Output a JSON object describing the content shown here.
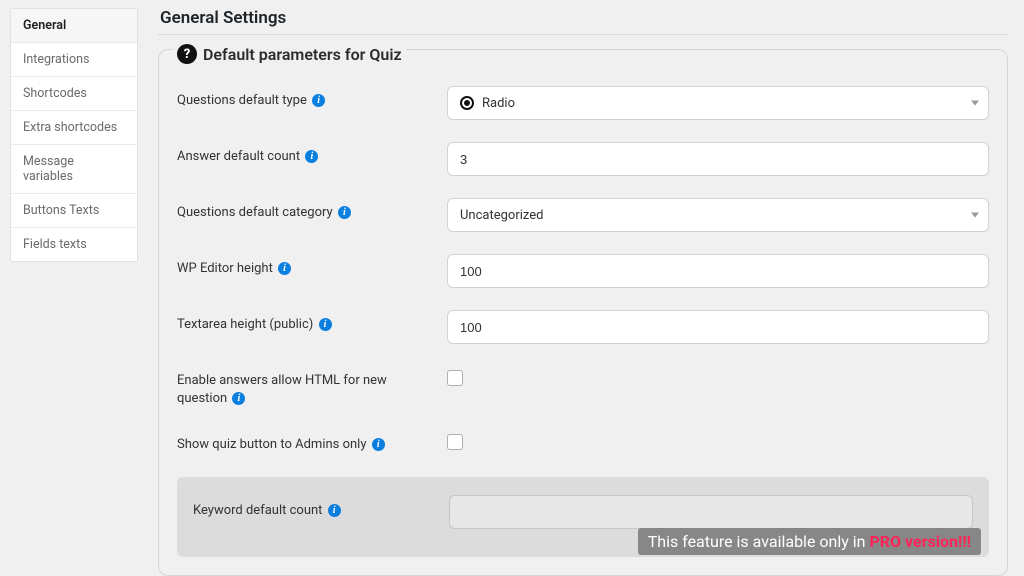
{
  "sidebar": {
    "items": [
      {
        "label": "General",
        "active": true
      },
      {
        "label": "Integrations",
        "active": false
      },
      {
        "label": "Shortcodes",
        "active": false
      },
      {
        "label": "Extra shortcodes",
        "active": false
      },
      {
        "label": "Message variables",
        "active": false
      },
      {
        "label": "Buttons Texts",
        "active": false
      },
      {
        "label": "Fields texts",
        "active": false
      }
    ]
  },
  "page_title": "General Settings",
  "panel": {
    "legend": "Default parameters for Quiz",
    "fields": {
      "question_type": {
        "label": "Questions default type",
        "value": "Radio"
      },
      "answer_count": {
        "label": "Answer default count",
        "value": "3"
      },
      "question_category": {
        "label": "Questions default category",
        "value": "Uncategorized"
      },
      "wp_editor_height": {
        "label": "WP Editor height",
        "value": "100"
      },
      "textarea_height": {
        "label": "Textarea height (public)",
        "value": "100"
      },
      "allow_html": {
        "label": "Enable answers allow HTML for new question",
        "checked": false
      },
      "admins_only": {
        "label": "Show quiz button to Admins only",
        "checked": false
      },
      "keyword_count": {
        "label": "Keyword default count"
      }
    },
    "pro_banner": {
      "prefix": "This feature is available only in ",
      "highlight": "PRO version!!!"
    }
  }
}
